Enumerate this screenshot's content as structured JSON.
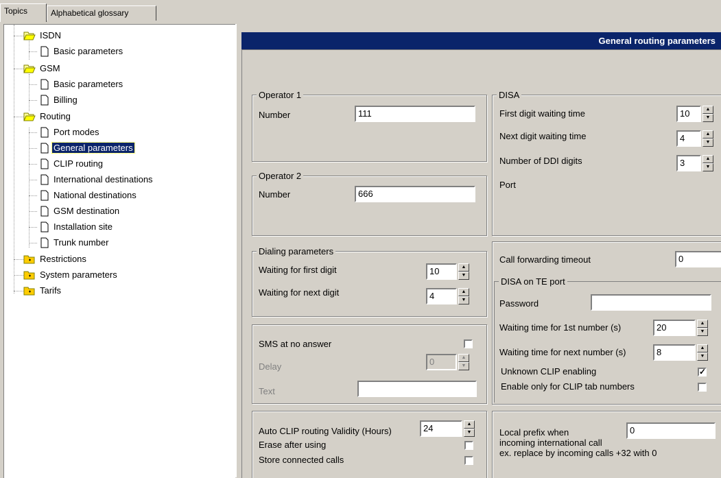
{
  "tabs": [
    {
      "label": "Topics"
    },
    {
      "label": "Alphabetical glossary"
    }
  ],
  "tree": {
    "isdn": {
      "label": "ISDN",
      "children": [
        "Basic parameters"
      ]
    },
    "gsm": {
      "label": "GSM",
      "children": [
        "Basic parameters",
        "Billing"
      ]
    },
    "routing": {
      "label": "Routing",
      "children": [
        "Port modes",
        "General parameters",
        "CLIP routing",
        "International destinations",
        "National destinations",
        "GSM destination",
        "Installation site",
        "Trunk number"
      ]
    },
    "restrictions": {
      "label": "Restrictions"
    },
    "system": {
      "label": "System parameters"
    },
    "tarifs": {
      "label": "Tarifs"
    }
  },
  "header": {
    "title": "General routing parameters"
  },
  "operator1": {
    "title": "Operator 1",
    "number_label": "Number",
    "number_value": "111"
  },
  "operator2": {
    "title": "Operator 2",
    "number_label": "Number",
    "number_value": "666"
  },
  "disa": {
    "title": "DISA",
    "first_digit_label": "First digit waiting time",
    "first_digit_value": "10",
    "next_digit_label": "Next digit waiting time",
    "next_digit_value": "4",
    "ddi_label": "Number of DDI digits",
    "ddi_value": "3",
    "port_label": "Port"
  },
  "dialing": {
    "title": "Dialing parameters",
    "first_label": "Waiting for first digit",
    "first_value": "10",
    "next_label": "Waiting for next digit",
    "next_value": "4"
  },
  "call_forwarding": {
    "label": "Call forwarding timeout",
    "value": "0"
  },
  "disa_te": {
    "title": "DISA on TE port",
    "password_label": "Password",
    "password_value": "",
    "wait_first_label": "Waiting time for 1st number (s)",
    "wait_first_value": "20",
    "wait_next_label": "Waiting time for next number (s)",
    "wait_next_value": "8",
    "unknown_clip_label": "Unknown CLIP enabling",
    "unknown_clip_checked": true,
    "clip_tab_label": "Enable only for CLIP tab numbers",
    "clip_tab_checked": false
  },
  "sms": {
    "no_answer_label": "SMS at no answer",
    "no_answer_checked": false,
    "delay_label": "Delay",
    "delay_value": "0",
    "text_label": "Text",
    "text_value": ""
  },
  "auto_clip": {
    "validity_label": "Auto CLIP routing Validity (Hours)",
    "validity_value": "24",
    "erase_label": "Erase after using",
    "erase_checked": false,
    "store_label": "Store connected calls",
    "store_checked": false
  },
  "local_prefix": {
    "line1": "Local prefix when",
    "line2": "incoming international call",
    "line3": "ex. replace by incoming calls +32 with 0",
    "value": "0"
  }
}
